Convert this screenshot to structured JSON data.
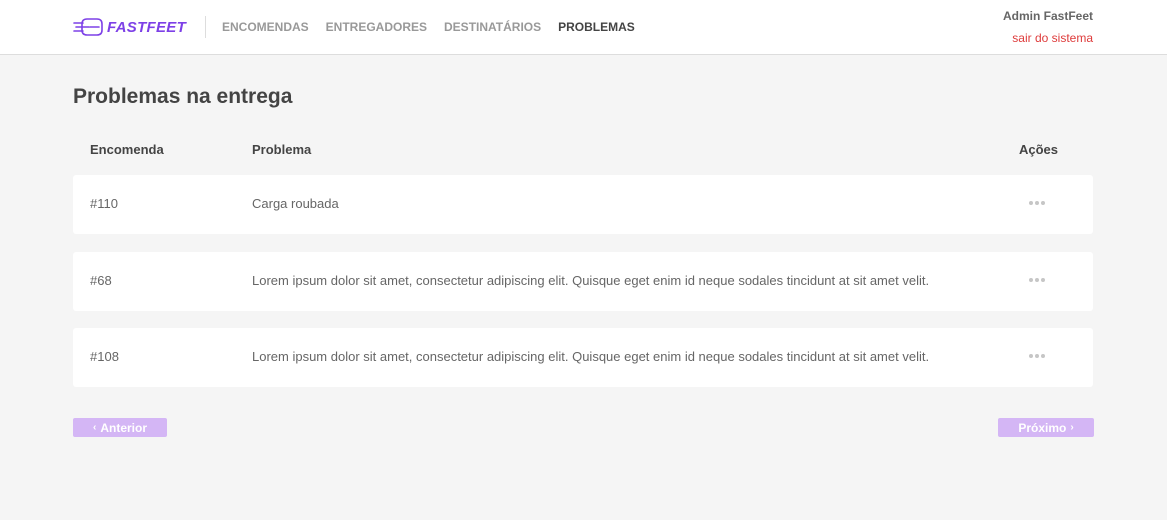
{
  "brand": {
    "name": "FASTFEET",
    "color": "#7d40e7"
  },
  "nav": [
    {
      "label": "ENCOMENDAS",
      "active": false
    },
    {
      "label": "ENTREGADORES",
      "active": false
    },
    {
      "label": "DESTINATÁRIOS",
      "active": false
    },
    {
      "label": "PROBLEMAS",
      "active": true
    }
  ],
  "profile": {
    "name": "Admin FastFeet",
    "logout": "sair do sistema"
  },
  "page": {
    "title": "Problemas na entrega"
  },
  "table": {
    "headers": {
      "order": "Encomenda",
      "problem": "Problema",
      "actions": "Ações"
    },
    "rows": [
      {
        "order": "#110",
        "problem": "Carga roubada"
      },
      {
        "order": "#68",
        "problem": "Lorem ipsum dolor sit amet, consectetur adipiscing elit. Quisque eget enim id neque sodales tincidunt at sit amet velit."
      },
      {
        "order": "#108",
        "problem": "Lorem ipsum dolor sit amet, consectetur adipiscing elit. Quisque eget enim id neque sodales tincidunt at sit amet velit."
      }
    ]
  },
  "pagination": {
    "prev": "Anterior",
    "next": "Próximo"
  },
  "icons": {
    "actions": "more-horizontal-icon",
    "prev": "chevron-left-icon",
    "next": "chevron-right-icon",
    "logo": "fast-delivery-icon"
  }
}
